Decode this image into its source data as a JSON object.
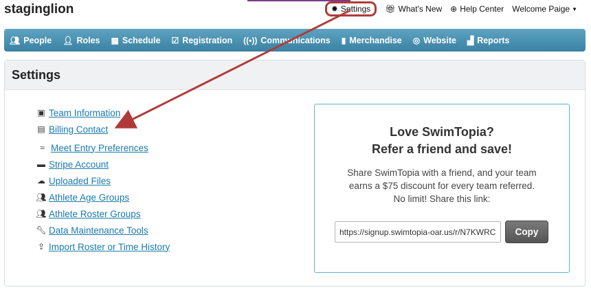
{
  "brand": {
    "name": "staginglion"
  },
  "topnav": {
    "settings": "Settings",
    "whats_new": "What's New",
    "help_center": "Help Center",
    "welcome": "Welcome Paige"
  },
  "mainnav": {
    "items": [
      {
        "label": "People",
        "icon": "people-icon"
      },
      {
        "label": "Roles",
        "icon": "roles-icon"
      },
      {
        "label": "Schedule",
        "icon": "calendar-icon"
      },
      {
        "label": "Registration",
        "icon": "checkbox-icon"
      },
      {
        "label": "Communications",
        "icon": "broadcast-icon"
      },
      {
        "label": "Merchandise",
        "icon": "book-icon"
      },
      {
        "label": "Website",
        "icon": "globe-icon"
      },
      {
        "label": "Reports",
        "icon": "bar-chart-icon"
      }
    ]
  },
  "panel": {
    "title": "Settings"
  },
  "links": [
    {
      "label": "Team Information",
      "icon": "contact-card-icon"
    },
    {
      "label": "Billing Contact",
      "icon": "id-card-icon"
    },
    {
      "label": "Meet Entry Preferences",
      "icon": "swimmer-icon"
    },
    {
      "label": "Stripe Account",
      "icon": "credit-card-icon"
    },
    {
      "label": "Uploaded Files",
      "icon": "cloud-upload-icon"
    },
    {
      "label": "Athlete Age Groups",
      "icon": "group-icon"
    },
    {
      "label": "Athlete Roster Groups",
      "icon": "group-icon"
    },
    {
      "label": "Data Maintenance Tools",
      "icon": "wrench-icon"
    },
    {
      "label": "Import Roster or Time History",
      "icon": "upload-icon"
    }
  ],
  "referral": {
    "heading_line1": "Love SwimTopia?",
    "heading_line2": "Refer a friend and save!",
    "body_line1": "Share SwimTopia with a friend, and your team",
    "body_line2": "earns a $75 discount for every team referred.",
    "body_line3": "No limit! Share this link:",
    "link_value": "https://signup.swimtopia-oar.us/r/N7KWRC",
    "copy_label": "Copy"
  },
  "colors": {
    "nav_bar": "#4a92b2",
    "link": "#1a7aab",
    "annotation": "#b03a3a",
    "referral_border": "#5db2cf"
  }
}
